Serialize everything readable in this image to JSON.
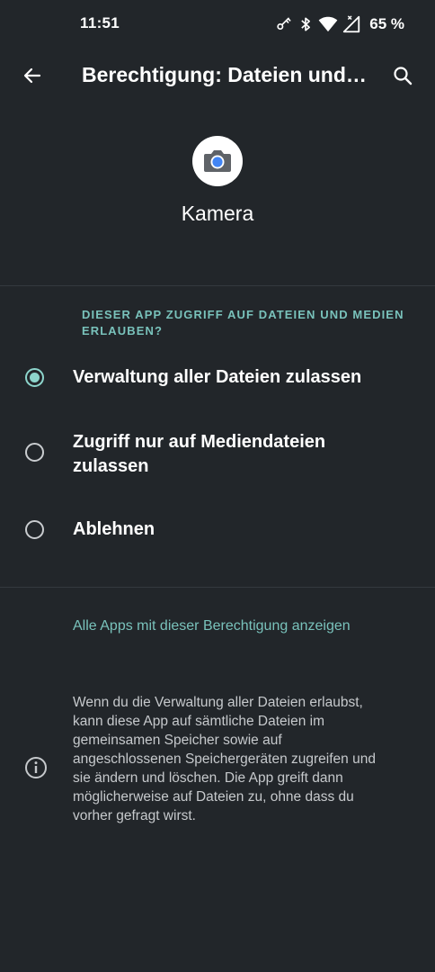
{
  "status_bar": {
    "time": "11:51",
    "battery": "65 %",
    "icons": [
      "vpn-key-icon",
      "bluetooth-icon",
      "wifi-icon",
      "cellular-signal-icon"
    ]
  },
  "app_bar": {
    "title": "Berechtigung: Dateien und Medien",
    "back_icon": "arrow-back-icon",
    "search_icon": "search-icon"
  },
  "app": {
    "name": "Kamera",
    "icon": "camera-app-icon"
  },
  "permission": {
    "header": "DIESER APP ZUGRIFF AUF DATEIEN UND MEDIEN ERLAUBEN?",
    "options": [
      {
        "label": "Verwaltung aller Dateien zulassen",
        "selected": true
      },
      {
        "label": "Zugriff nur auf Mediendateien zulassen",
        "selected": false
      },
      {
        "label": "Ablehnen",
        "selected": false
      }
    ]
  },
  "link": {
    "label": "Alle Apps mit dieser Berechtigung anzeigen"
  },
  "info": {
    "text": "Wenn du die Verwaltung aller Dateien erlaubst, kann diese App auf sämtliche Dateien im gemeinsamen Speicher sowie auf angeschlossenen Speichergeräten zugreifen und sie ändern und löschen. Die App greift dann möglicherweise auf Dateien zu, ohne dass du vorher gefragt wirst.",
    "icon": "info-icon"
  },
  "colors": {
    "background": "#22262a",
    "accent": "#79c2bb",
    "radio_selected": "#8dd5cc"
  }
}
